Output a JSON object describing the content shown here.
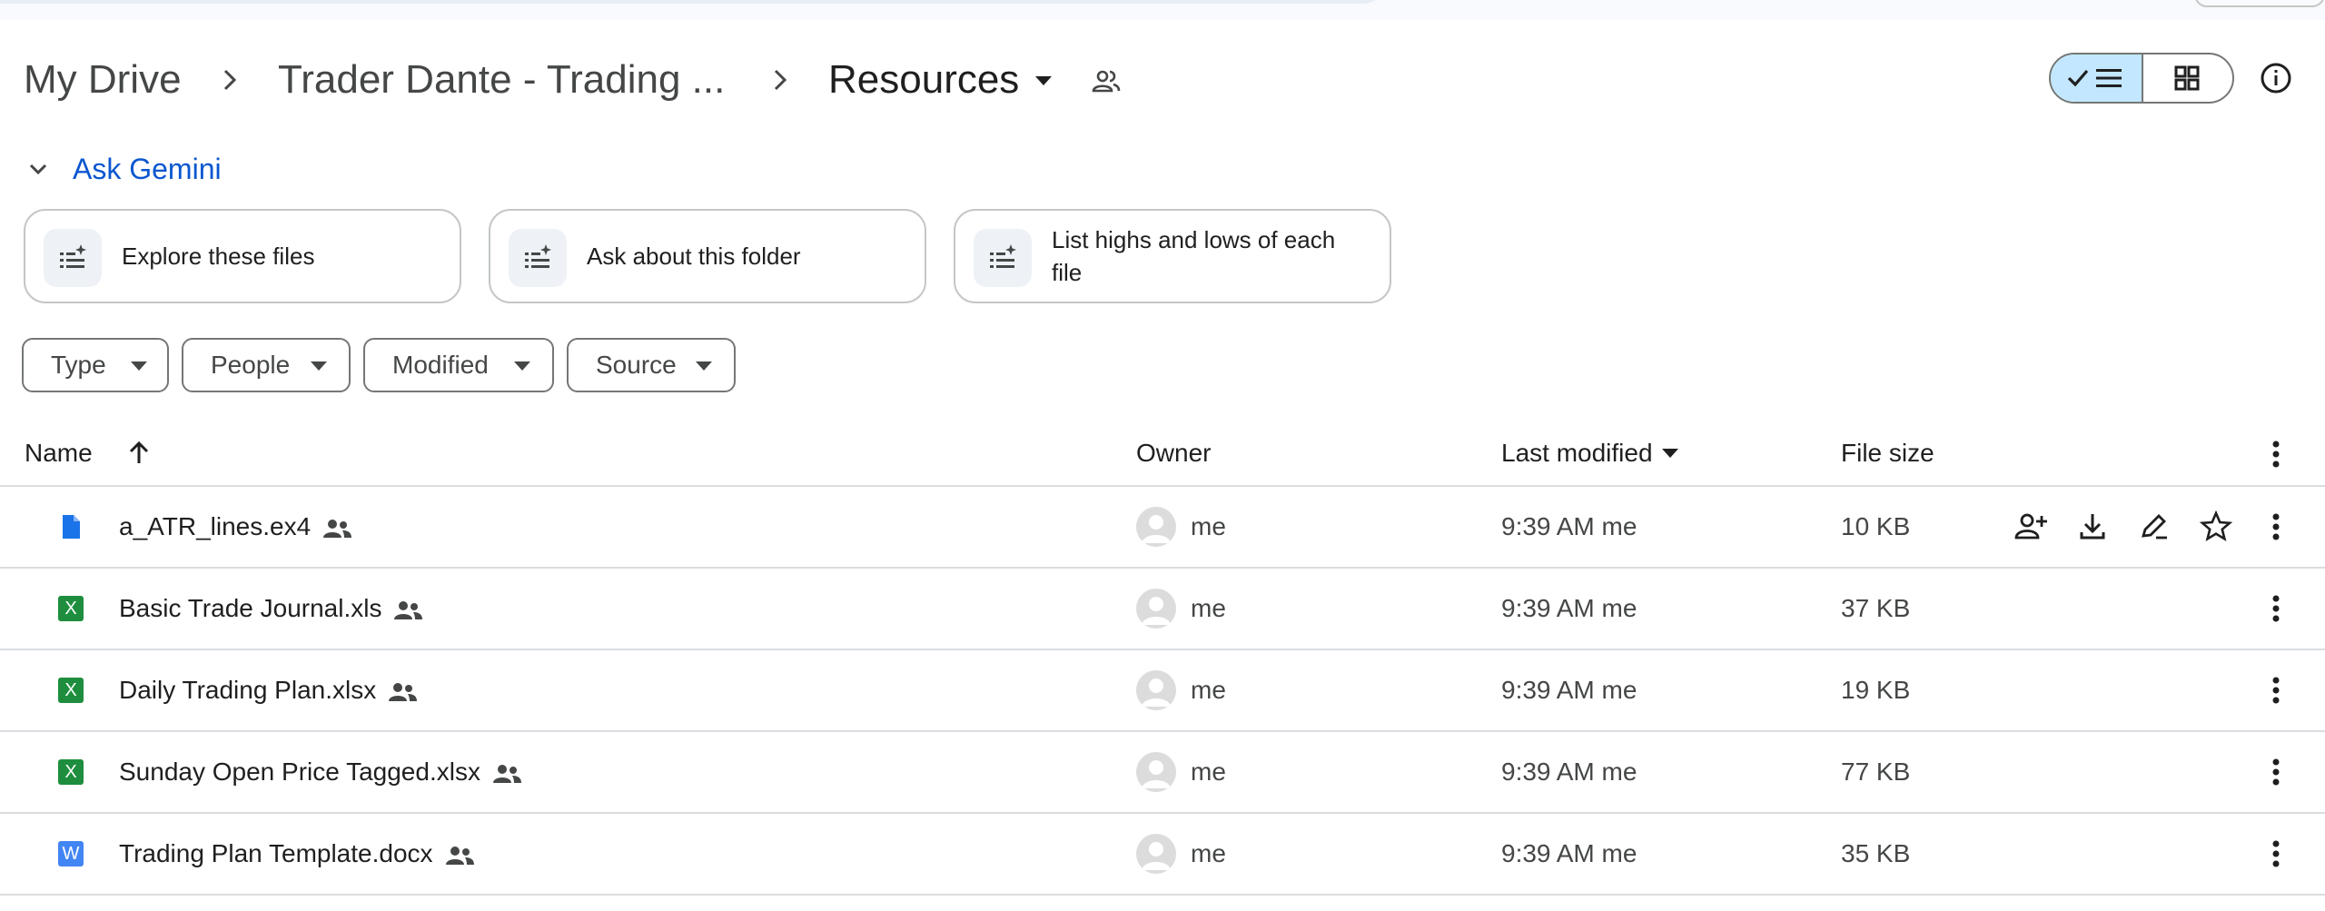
{
  "breadcrumb": {
    "root": "My Drive",
    "parent": "Trader Dante - Trading ...",
    "current": "Resources"
  },
  "gemini": {
    "label": "Ask Gemini",
    "suggestions": [
      {
        "label": "Explore these files"
      },
      {
        "label": "Ask about this folder"
      },
      {
        "label": "List highs and lows of each file"
      }
    ]
  },
  "filters": [
    {
      "label": "Type"
    },
    {
      "label": "People"
    },
    {
      "label": "Modified"
    },
    {
      "label": "Source"
    }
  ],
  "table": {
    "columns": {
      "name": "Name",
      "owner": "Owner",
      "modified": "Last modified",
      "size": "File size"
    },
    "rows": [
      {
        "name": "a_ATR_lines.ex4",
        "type": "file",
        "owner": "me",
        "modified": "9:39 AM me",
        "size": "10 KB"
      },
      {
        "name": "Basic Trade Journal.xls",
        "type": "excel",
        "owner": "me",
        "modified": "9:39 AM me",
        "size": "37 KB"
      },
      {
        "name": "Daily Trading Plan.xlsx",
        "type": "excel",
        "owner": "me",
        "modified": "9:39 AM me",
        "size": "19 KB"
      },
      {
        "name": "Sunday Open Price Tagged.xlsx",
        "type": "excel",
        "owner": "me",
        "modified": "9:39 AM me",
        "size": "77 KB"
      },
      {
        "name": "Trading Plan Template.docx",
        "type": "word",
        "owner": "me",
        "modified": "9:39 AM me",
        "size": "35 KB"
      }
    ]
  },
  "icons": {
    "excel_letter": "X",
    "word_letter": "W"
  },
  "colors": {
    "accent": "#0b57d0",
    "toggle_active": "#c2e7ff",
    "excel": "#1e8e3e",
    "word": "#4285f4",
    "doc": "#1a73e8"
  }
}
